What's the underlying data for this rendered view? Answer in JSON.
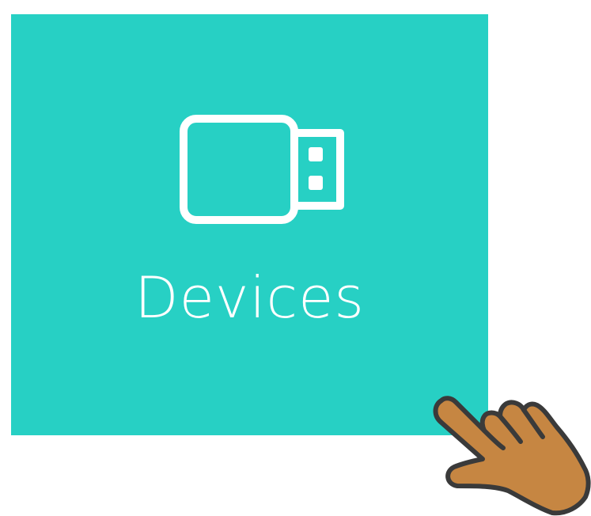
{
  "tile": {
    "label": "Devices",
    "icon": "usb-drive-icon",
    "background": "#27d0c4",
    "foreground": "#ffffff"
  },
  "cursor": {
    "icon": "pointing-hand-icon",
    "skin": "#c68642",
    "outline": "#3a3a3a"
  }
}
